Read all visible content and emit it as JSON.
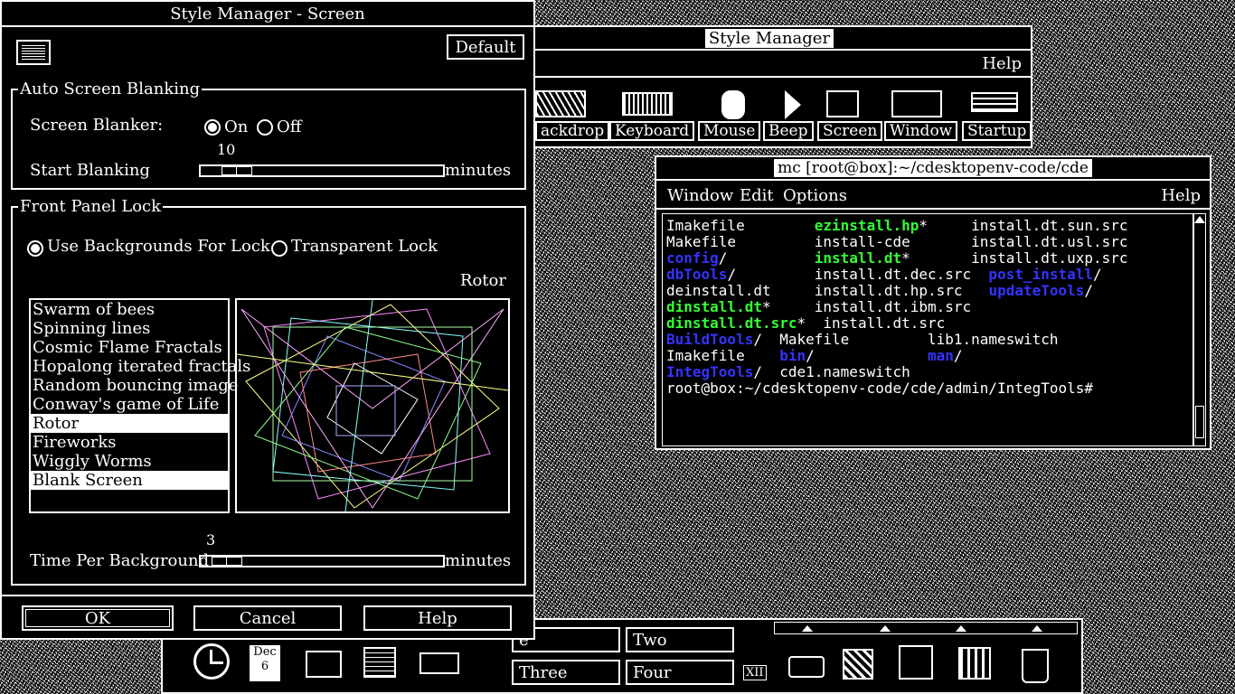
{
  "style_manager_main": {
    "title": "Style Manager",
    "menu_help": "Help",
    "toolbar": [
      "ackdrop",
      "Keyboard",
      "Mouse",
      "Beep",
      "Screen",
      "Window",
      "Startup"
    ]
  },
  "terminal": {
    "title": "mc [root@box]:~/cdesktopenv-code/cde",
    "menu": [
      "Window",
      "Edit",
      "Options"
    ],
    "menu_help": "Help",
    "lines": [
      [
        {
          "t": "Imakefile        ",
          "c": "#ffffff"
        },
        {
          "t": "ezinstall.hp",
          "c": "#33ff33",
          "b": true
        },
        {
          "t": "*     ",
          "c": "#ffffff"
        },
        {
          "t": "install.dt.sun.src",
          "c": "#ffffff"
        }
      ],
      [
        {
          "t": "Makefile         ",
          "c": "#ffffff"
        },
        {
          "t": "install-cde",
          "c": "#ffffff"
        },
        {
          "t": "       ",
          "c": "#ffffff"
        },
        {
          "t": "install.dt.usl.src",
          "c": "#ffffff"
        }
      ],
      [
        {
          "t": "config",
          "c": "#3333ff",
          "b": true
        },
        {
          "t": "/          ",
          "c": "#ffffff"
        },
        {
          "t": "install.dt",
          "c": "#33ff33",
          "b": true
        },
        {
          "t": "*       ",
          "c": "#ffffff"
        },
        {
          "t": "install.dt.uxp.src",
          "c": "#ffffff"
        }
      ],
      [
        {
          "t": "dbTools",
          "c": "#3333ff",
          "b": true
        },
        {
          "t": "/         ",
          "c": "#ffffff"
        },
        {
          "t": "install.dt.dec.src",
          "c": "#ffffff"
        },
        {
          "t": "  ",
          "c": "#ffffff"
        },
        {
          "t": "post_install",
          "c": "#3333ff",
          "b": true
        },
        {
          "t": "/",
          "c": "#ffffff"
        }
      ],
      [
        {
          "t": "deinstall.dt     ",
          "c": "#ffffff"
        },
        {
          "t": "install.dt.hp.src",
          "c": "#ffffff"
        },
        {
          "t": "   ",
          "c": "#ffffff"
        },
        {
          "t": "updateTools",
          "c": "#3333ff",
          "b": true
        },
        {
          "t": "/",
          "c": "#ffffff"
        }
      ],
      [
        {
          "t": "dinstall.dt",
          "c": "#33ff33",
          "b": true
        },
        {
          "t": "*     ",
          "c": "#ffffff"
        },
        {
          "t": "install.dt.ibm.src",
          "c": "#ffffff"
        }
      ],
      [
        {
          "t": "dinstall.dt.src",
          "c": "#33ff33",
          "b": true
        },
        {
          "t": "*  ",
          "c": "#ffffff"
        },
        {
          "t": "install.dt.src",
          "c": "#ffffff"
        }
      ],
      [
        {
          "t": "BuildTools",
          "c": "#3333ff",
          "b": true
        },
        {
          "t": "/  ",
          "c": "#ffffff"
        },
        {
          "t": "Makefile         lib1.nameswitch",
          "c": "#ffffff"
        }
      ],
      [
        {
          "t": "Imakefile    ",
          "c": "#ffffff"
        },
        {
          "t": "bin",
          "c": "#3333ff",
          "b": true
        },
        {
          "t": "/             ",
          "c": "#ffffff"
        },
        {
          "t": "man",
          "c": "#3333ff",
          "b": true
        },
        {
          "t": "/",
          "c": "#ffffff"
        }
      ],
      [
        {
          "t": "IntegTools",
          "c": "#3333ff",
          "b": true
        },
        {
          "t": "/  ",
          "c": "#ffffff"
        },
        {
          "t": "cde1.nameswitch",
          "c": "#ffffff"
        }
      ],
      [
        {
          "t": "root@box:~/cdesktopenv-code/cde/admin/IntegTools#",
          "c": "#ffffff"
        }
      ]
    ]
  },
  "screen_dialog": {
    "title": "Style Manager - Screen",
    "default_button": "Default",
    "auto_blanking": {
      "legend": "Auto Screen Blanking",
      "blanker_label": "Screen Blanker:",
      "on_label": "On",
      "off_label": "Off",
      "selected": "On",
      "start_label": "Start Blanking",
      "start_value": "10",
      "start_fraction": 0.1,
      "units": "minutes"
    },
    "lock": {
      "legend": "Front Panel Lock",
      "use_backgrounds": "Use Backgrounds For Lock",
      "transparent": "Transparent Lock",
      "selected": "Use Backgrounds For Lock",
      "preview_name": "Rotor",
      "list": [
        {
          "label": "Swarm of bees",
          "selected": false
        },
        {
          "label": "Spinning lines",
          "selected": false
        },
        {
          "label": "Cosmic Flame Fractals",
          "selected": false
        },
        {
          "label": "Hopalong iterated fractals",
          "selected": false
        },
        {
          "label": "Random bouncing image",
          "selected": false
        },
        {
          "label": "Conway's game of Life",
          "selected": false
        },
        {
          "label": "Rotor",
          "selected": true
        },
        {
          "label": "Fireworks",
          "selected": false
        },
        {
          "label": "Wiggly Worms",
          "selected": false
        },
        {
          "label": "Blank Screen",
          "selected": true
        }
      ],
      "time_label": "Time Per Background",
      "time_value": "3",
      "time_fraction": 0.05,
      "units": "minutes"
    },
    "buttons": {
      "ok": "OK",
      "cancel": "Cancel",
      "help": "Help"
    }
  },
  "front_panel": {
    "workspaces": [
      "e",
      "Two",
      "Three",
      "Four"
    ],
    "date_month": "Dec",
    "date_day": "6",
    "xii_label": "XII"
  }
}
